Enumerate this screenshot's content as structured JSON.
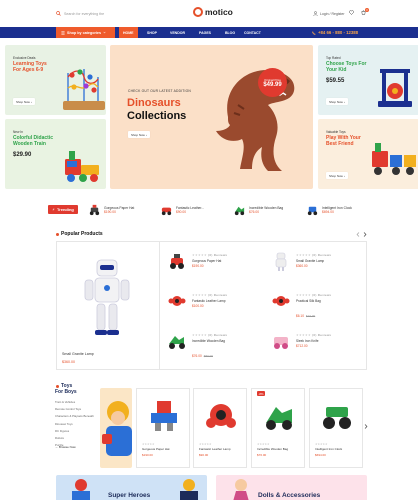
{
  "header": {
    "search_placeholder": "Search for everything the",
    "logo_text": "motico",
    "account_label": "Login / Register",
    "cart_count": "0"
  },
  "nav": {
    "categories_label": "Shop by categories",
    "items": [
      "HOME",
      "SHOP",
      "VENDOR",
      "PAGES",
      "BLOG",
      "CONTACT"
    ],
    "phone": "+84 66 - 880 - 12388"
  },
  "banners": {
    "left_top": {
      "small": "Exclusive Deals",
      "title": "Learning Toys For Ages 6-9",
      "button": "Shop Now"
    },
    "left_bottom": {
      "small": "New In",
      "title": "Colorful Didactic Wooden Train",
      "price": "$29.90"
    },
    "hero": {
      "small": "CHECK OUT OUR LATEST ADDITION",
      "title1": "Dinosaurs",
      "title2": "Collections",
      "button": "Shop Now",
      "badge_small": "Original Price",
      "badge_price": "$49.99"
    },
    "right_top": {
      "small": "Top Rated",
      "title": "Choose Toys For Your Kid",
      "price": "$59.55",
      "button": "Shop Now"
    },
    "right_bottom": {
      "small": "Valuable Toys",
      "title": "Play With Your Best Friend",
      "button": "Shop Now"
    }
  },
  "trending": {
    "label": "Trending",
    "items": [
      {
        "name": "Gorgeous Paper Hat",
        "price": "$190.00"
      },
      {
        "name": "Fantastic Leather...",
        "price": "$90.00"
      },
      {
        "name": "Incredible Wooden Bag",
        "price": "$76.00"
      },
      {
        "name": "Intelligent Iron Clock",
        "price": "$694.00"
      }
    ]
  },
  "popular": {
    "title": "Popular Products",
    "featured": {
      "name": "Small Granite Lamp",
      "price": "$360.00"
    },
    "items": [
      {
        "name": "Gorgeous Paper Hat",
        "price": "$190.00",
        "old": ""
      },
      {
        "name": "Small Granite Lamp",
        "price": "$360.00",
        "old": ""
      },
      {
        "name": "Fantastic Leather Lamp",
        "price": "$100.00",
        "old": ""
      },
      {
        "name": "Practical Silk Bag",
        "price": "$6.10",
        "old": "$10.00"
      },
      {
        "name": "Incredible Wooden Bag",
        "price": "$76.00",
        "old": "$80.00"
      },
      {
        "name": "Sleek Iron Knife",
        "price": "$712.00",
        "old": ""
      }
    ],
    "reviews": "(0) Reviews",
    "stars": "★★★★★"
  },
  "toys": {
    "title1": "Toys",
    "title2": "For Boys",
    "list": [
      "Train & Vehicles",
      "Remote Control Toys",
      "Characters & Playsets Beneath",
      "Dinosaur Toys",
      "RC Figures",
      "Robots",
      "Puzzle"
    ],
    "browse": "Browse Now",
    "cards": [
      {
        "name": "Gorgeous Paper Hat",
        "price": "$190.00",
        "sale": ""
      },
      {
        "name": "Fantastic Leather Lamp",
        "price": "$90.00",
        "sale": ""
      },
      {
        "name": "Incredible Wooden Bag",
        "price": "$76.00",
        "sale": "-8%"
      },
      {
        "name": "Intelligent Iron Clock",
        "price": "$694.00",
        "sale": ""
      }
    ]
  },
  "categories": [
    {
      "title": "Super Heroes"
    },
    {
      "title": "Dolls & Accessories"
    }
  ],
  "colors": {
    "accent": "#ef5b2c",
    "navy": "#1b2f8f",
    "sale": "#e03a2f"
  }
}
